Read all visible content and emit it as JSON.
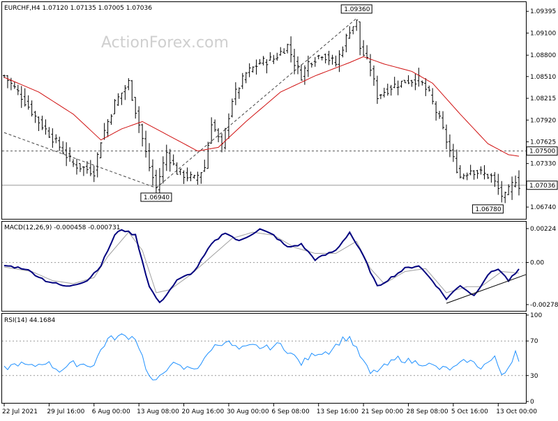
{
  "watermark": "ActionForex.com",
  "colors": {
    "frame": "#000000",
    "grid": "#c0c0c0",
    "bars": "#000000",
    "ma": "#d01010",
    "macd": "#00007f",
    "signal": "#a0a0a0",
    "rsi": "#1e90ff",
    "hline": "#888888",
    "trend": "#000000",
    "watermark": "#cfcfcf"
  },
  "chart_data": [
    {
      "type": "line",
      "panel": "price",
      "title": "EURCHF,H4  1.07120 1.07135 1.07005 1.07036",
      "ylim": [
        1.0658,
        1.0952
      ],
      "y_ticks": [
        "1.09395",
        "1.09100",
        "1.08800",
        "1.08510",
        "1.08215",
        "1.07920",
        "1.07625",
        "1.07330",
        "1.06740"
      ],
      "y_tick_values": [
        1.09395,
        1.091,
        1.088,
        1.0851,
        1.08215,
        1.0792,
        1.07625,
        1.0733,
        1.0674
      ],
      "price_tags": [
        {
          "text": "1.07500",
          "value": 1.075
        },
        {
          "text": "1.07036",
          "value": 1.07036
        }
      ],
      "annotations": [
        {
          "text": "1.09360",
          "x": 102,
          "value": 1.0936
        },
        {
          "text": "1.06940",
          "x": 44,
          "value": 1.0694
        },
        {
          "text": "1.06780",
          "x": 140,
          "value": 1.0678
        }
      ],
      "hlines": [
        1.075,
        1.07036
      ],
      "x_labels": [
        "22 Jul 2021",
        "29 Jul 16:00",
        "6 Aug 00:00",
        "13 Aug 08:00",
        "20 Aug 16:00",
        "30 Aug 00:00",
        "6 Sep 08:00",
        "13 Sep 16:00",
        "21 Sep 00:00",
        "28 Sep 08:00",
        "5 Oct 16:00",
        "13 Oct 00:00"
      ],
      "x_label_index": [
        0,
        13,
        26,
        39,
        52,
        65,
        78,
        91,
        104,
        117,
        130,
        143
      ],
      "n_bars": 150,
      "price_anchors": [
        [
          0,
          1.0852
        ],
        [
          5,
          1.0824
        ],
        [
          10,
          1.079
        ],
        [
          15,
          1.0762
        ],
        [
          20,
          1.0732
        ],
        [
          26,
          1.0722
        ],
        [
          28,
          1.0765
        ],
        [
          32,
          1.0815
        ],
        [
          36,
          1.0843
        ],
        [
          39,
          1.0786
        ],
        [
          42,
          1.0728
        ],
        [
          44,
          1.07
        ],
        [
          47,
          1.0748
        ],
        [
          50,
          1.0722
        ],
        [
          55,
          1.0712
        ],
        [
          58,
          1.0728
        ],
        [
          60,
          1.079
        ],
        [
          63,
          1.0755
        ],
        [
          66,
          1.082
        ],
        [
          70,
          1.0855
        ],
        [
          74,
          1.087
        ],
        [
          78,
          1.0875
        ],
        [
          82,
          1.0893
        ],
        [
          84,
          1.087
        ],
        [
          86,
          1.0852
        ],
        [
          88,
          1.087
        ],
        [
          92,
          1.0882
        ],
        [
          96,
          1.0868
        ],
        [
          100,
          1.0915
        ],
        [
          102,
          1.0925
        ],
        [
          103,
          1.089
        ],
        [
          106,
          1.0862
        ],
        [
          108,
          1.0825
        ],
        [
          112,
          1.0837
        ],
        [
          116,
          1.0845
        ],
        [
          120,
          1.0847
        ],
        [
          123,
          1.0827
        ],
        [
          126,
          1.0792
        ],
        [
          129,
          1.075
        ],
        [
          132,
          1.0715
        ],
        [
          135,
          1.0725
        ],
        [
          138,
          1.072
        ],
        [
          141,
          1.0715
        ],
        [
          144,
          1.069
        ],
        [
          145,
          1.0688
        ],
        [
          148,
          1.0712
        ],
        [
          149,
          1.0704
        ]
      ],
      "ma_anchors": [
        [
          0,
          1.085
        ],
        [
          10,
          1.083
        ],
        [
          20,
          1.08
        ],
        [
          28,
          1.0765
        ],
        [
          34,
          1.078
        ],
        [
          40,
          1.079
        ],
        [
          48,
          1.077
        ],
        [
          56,
          1.075
        ],
        [
          62,
          1.0755
        ],
        [
          70,
          1.079
        ],
        [
          80,
          1.083
        ],
        [
          90,
          1.0852
        ],
        [
          100,
          1.087
        ],
        [
          104,
          1.0878
        ],
        [
          110,
          1.0868
        ],
        [
          118,
          1.0858
        ],
        [
          124,
          1.0842
        ],
        [
          132,
          1.08
        ],
        [
          140,
          1.076
        ],
        [
          146,
          1.0745
        ],
        [
          149,
          1.0743
        ]
      ],
      "trendlines": [
        {
          "from": [
            0,
            1.0775
          ],
          "to": [
            44,
            1.07
          ],
          "style": "dashed"
        },
        {
          "from": [
            44,
            1.07
          ],
          "to": [
            102,
            1.093
          ],
          "style": "dashed"
        }
      ]
    },
    {
      "type": "line",
      "panel": "macd",
      "title": "MACD(12,26,9) -0.000458 -0.000731",
      "ylim": [
        -0.0032,
        0.0027
      ],
      "y_ticks": [
        "0.00224",
        "0.00",
        "-0.002785"
      ],
      "y_tick_values": [
        0.00224,
        0.0,
        -0.002785
      ],
      "hline": 0.0,
      "series": [
        {
          "name": "MACD",
          "anchors": [
            [
              0,
              -0.0002
            ],
            [
              6,
              -0.0004
            ],
            [
              12,
              -0.0012
            ],
            [
              18,
              -0.0016
            ],
            [
              24,
              -0.0012
            ],
            [
              28,
              -0.0002
            ],
            [
              32,
              0.0018
            ],
            [
              34,
              0.0022
            ],
            [
              38,
              0.0018
            ],
            [
              42,
              -0.0016
            ],
            [
              45,
              -0.0027
            ],
            [
              50,
              -0.0012
            ],
            [
              55,
              -0.0006
            ],
            [
              60,
              0.0012
            ],
            [
              64,
              0.002
            ],
            [
              68,
              0.0014
            ],
            [
              74,
              0.0022
            ],
            [
              78,
              0.0018
            ],
            [
              82,
              0.001
            ],
            [
              86,
              0.0012
            ],
            [
              90,
              0.0002
            ],
            [
              96,
              0.0008
            ],
            [
              100,
              0.002
            ],
            [
              104,
              0.0004
            ],
            [
              108,
              -0.0016
            ],
            [
              112,
              -0.001
            ],
            [
              116,
              -0.0004
            ],
            [
              120,
              -0.0002
            ],
            [
              124,
              -0.0012
            ],
            [
              128,
              -0.0024
            ],
            [
              132,
              -0.0015
            ],
            [
              136,
              -0.0022
            ],
            [
              140,
              -0.0008
            ],
            [
              143,
              -0.0004
            ],
            [
              146,
              -0.0012
            ],
            [
              149,
              -0.0005
            ]
          ]
        },
        {
          "name": "Signal",
          "anchors": [
            [
              0,
              -0.0003
            ],
            [
              8,
              -0.0006
            ],
            [
              14,
              -0.0012
            ],
            [
              20,
              -0.0014
            ],
            [
              26,
              -0.001
            ],
            [
              30,
              0.0004
            ],
            [
              36,
              0.002
            ],
            [
              40,
              0.0008
            ],
            [
              44,
              -0.002
            ],
            [
              48,
              -0.0018
            ],
            [
              54,
              -0.0008
            ],
            [
              60,
              0.0004
            ],
            [
              66,
              0.0016
            ],
            [
              72,
              0.002
            ],
            [
              78,
              0.0018
            ],
            [
              84,
              0.001
            ],
            [
              90,
              0.0006
            ],
            [
              96,
              0.0006
            ],
            [
              102,
              0.0014
            ],
            [
              106,
              -0.0004
            ],
            [
              110,
              -0.0014
            ],
            [
              116,
              -0.0006
            ],
            [
              122,
              -0.0004
            ],
            [
              128,
              -0.002
            ],
            [
              134,
              -0.0016
            ],
            [
              138,
              -0.0016
            ],
            [
              144,
              -0.0006
            ],
            [
              149,
              -0.0007
            ]
          ]
        }
      ],
      "trendlines": [
        {
          "from": [
            128,
            -0.0027
          ],
          "to": [
            149,
            -0.0008
          ],
          "style": "solid"
        }
      ]
    },
    {
      "type": "line",
      "panel": "rsi",
      "title": "RSI(14) 44.1684",
      "ylim": [
        0,
        100
      ],
      "y_ticks": [
        "100",
        "70",
        "30",
        "0"
      ],
      "y_tick_values": [
        100,
        70,
        30,
        0
      ],
      "hlines": [
        70,
        30
      ],
      "series": [
        {
          "name": "RSI",
          "anchors": [
            [
              0,
              38
            ],
            [
              4,
              44
            ],
            [
              8,
              40
            ],
            [
              12,
              46
            ],
            [
              16,
              36
            ],
            [
              20,
              44
            ],
            [
              26,
              42
            ],
            [
              28,
              60
            ],
            [
              30,
              72
            ],
            [
              34,
              76
            ],
            [
              38,
              74
            ],
            [
              40,
              52
            ],
            [
              42,
              28
            ],
            [
              44,
              22
            ],
            [
              48,
              44
            ],
            [
              52,
              38
            ],
            [
              56,
              40
            ],
            [
              58,
              48
            ],
            [
              60,
              62
            ],
            [
              64,
              70
            ],
            [
              68,
              60
            ],
            [
              72,
              64
            ],
            [
              76,
              62
            ],
            [
              80,
              66
            ],
            [
              84,
              52
            ],
            [
              86,
              44
            ],
            [
              90,
              56
            ],
            [
              94,
              58
            ],
            [
              98,
              72
            ],
            [
              100,
              74
            ],
            [
              102,
              60
            ],
            [
              104,
              46
            ],
            [
              106,
              32
            ],
            [
              110,
              40
            ],
            [
              114,
              50
            ],
            [
              118,
              46
            ],
            [
              122,
              44
            ],
            [
              126,
              38
            ],
            [
              130,
              38
            ],
            [
              134,
              48
            ],
            [
              138,
              40
            ],
            [
              142,
              50
            ],
            [
              144,
              32
            ],
            [
              146,
              40
            ],
            [
              148,
              58
            ],
            [
              149,
              44
            ]
          ]
        }
      ]
    }
  ]
}
